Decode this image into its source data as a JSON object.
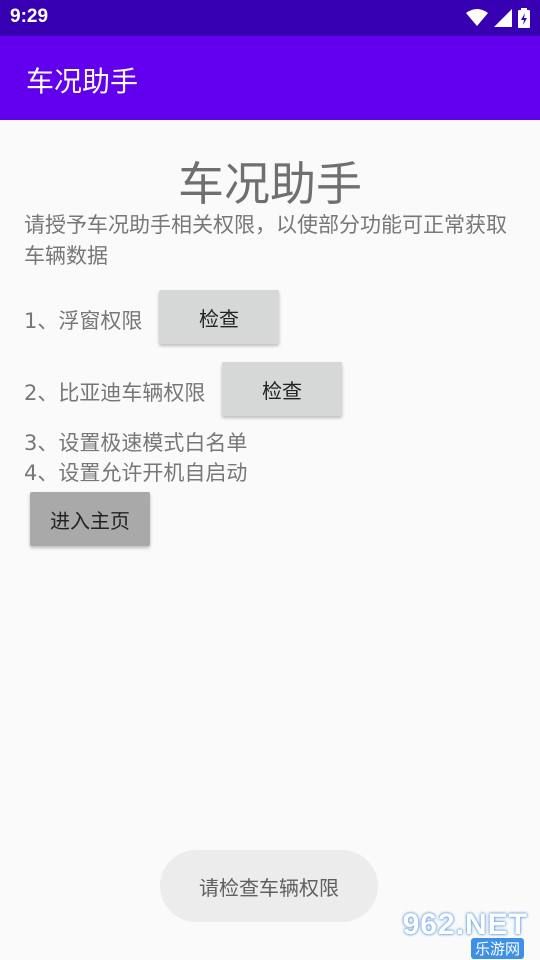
{
  "status_bar": {
    "time": "9:29",
    "icons": [
      "wifi-icon",
      "signal-icon",
      "battery-icon"
    ]
  },
  "app_bar": {
    "title": "车况助手"
  },
  "main": {
    "heading": "车况助手",
    "description": "请授予车况助手相关权限，以使部分功能可正常获取车辆数据",
    "permissions": [
      {
        "label": "1、浮窗权限",
        "button": "检查"
      },
      {
        "label": "2、比亚迪车辆权限",
        "button": "检查"
      }
    ],
    "steps": [
      "3、设置极速模式白名单",
      "4、设置允许开机自启动"
    ],
    "enter_button": "进入主页"
  },
  "toast": {
    "text": "请检查车辆权限"
  },
  "watermark": {
    "line1": "962.NET",
    "line2": "乐游网"
  },
  "colors": {
    "status_bar": "#3700b3",
    "app_bar": "#6200ee",
    "background": "#fafafa",
    "button": "#d6d7d7"
  }
}
